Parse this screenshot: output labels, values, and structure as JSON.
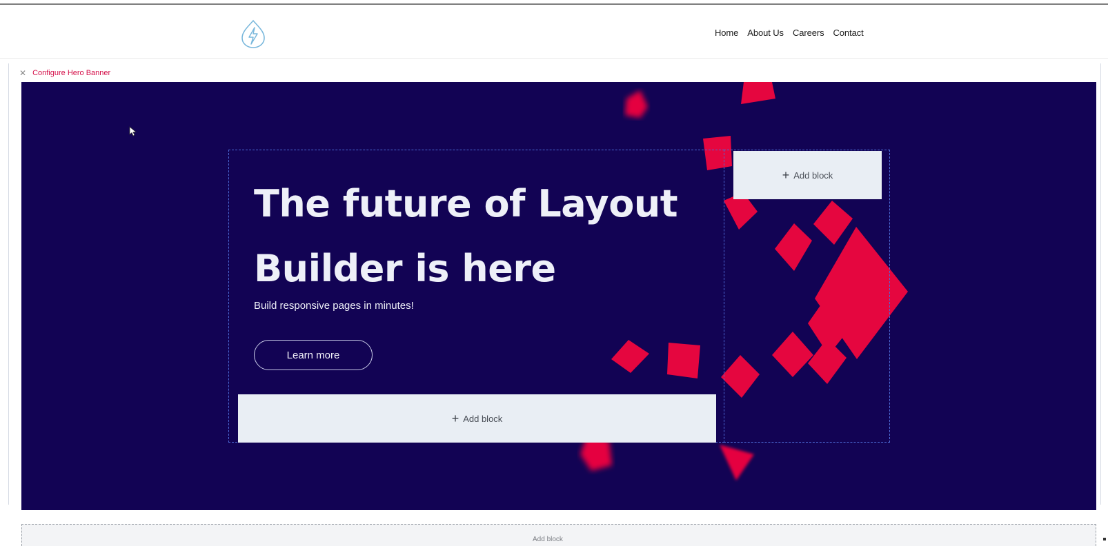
{
  "header": {
    "logo_icon": "bolt-drop-logo-icon",
    "nav": [
      "Home",
      "About Us",
      "Careers",
      "Contact"
    ]
  },
  "config_bar": {
    "close_icon": "close-icon",
    "label": "Configure Hero Banner"
  },
  "hero": {
    "title_line1": "The future of Layout",
    "title_line2": "Builder is here",
    "subtitle": "Build responsive pages in minutes!",
    "button_label": "Learn more",
    "add_block_main": "Add block",
    "add_block_side": "Add block"
  },
  "lower_section": {
    "hint": "Add block"
  },
  "colors": {
    "hero_bg": "#120354",
    "accent": "#e5063f",
    "add_block_bg": "#e9eef4",
    "config_label": "#d40e48"
  }
}
